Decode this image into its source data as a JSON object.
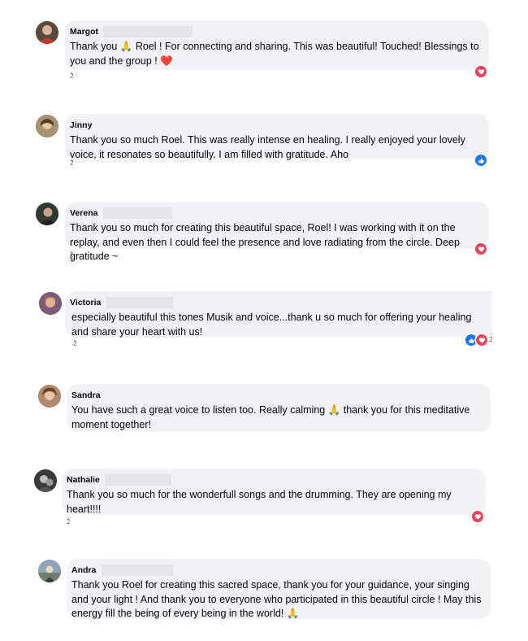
{
  "comments": [
    {
      "author": "Margot",
      "text": "Thank you 🙏 Roel ! For connecting and sharing. This was beautiful! Touched! Blessings to you and the group ! ❤️",
      "meta": "ُ2",
      "reactions": [
        "love"
      ],
      "colors": {
        "avatar_bg": "#5a4a3e",
        "avatar_fg": "#d8b59a"
      }
    },
    {
      "author": "Jinny",
      "text": "Thank you so much Roel. This was really intense en healing. I really enjoyed your lovely voice, it resonates so beautifully. I am filled with gratitude. Aho",
      "meta": "ُ2",
      "reactions": [
        "like"
      ],
      "colors": {
        "avatar_bg": "#a89270",
        "avatar_fg": "#e2c9a8"
      }
    },
    {
      "author": "Verena",
      "text": "Thank you so much for creating this beautiful space, Roel! I was working with it on the replay, and even then I could feel the presence and love radiating from the circle. Deep gratitude ~",
      "meta": "ُ2",
      "reactions": [
        "love"
      ],
      "colors": {
        "avatar_bg": "#2f3a30",
        "avatar_fg": "#c9a38a"
      }
    },
    {
      "author": "Victoria",
      "text": "especially beautiful this tones Musik and voice...thank u so much for offering your healing and share your heart with us!",
      "meta": "ُ2",
      "reactions": [
        "like",
        "love"
      ],
      "reaction_count": "2",
      "colors": {
        "avatar_bg": "#7d5a78",
        "avatar_fg": "#e0b48f"
      }
    },
    {
      "author": "Sandra",
      "text": "You have such a great voice to listen too. Really calming 🙏 thank you for this meditative moment together!",
      "meta": "",
      "reactions": [],
      "colors": {
        "avatar_bg": "#b08a6a",
        "avatar_fg": "#e6c6a8"
      }
    },
    {
      "author": "Nathalie",
      "text": "Thank you so much for the wonderfull songs and the drumming. They are opening my heart!!!!",
      "meta": "ُ2",
      "reactions": [
        "love"
      ],
      "colors": {
        "avatar_bg": "#3a3a3a",
        "avatar_fg": "#bdbdbd"
      }
    },
    {
      "author": "Andra",
      "text": "Thank you Roel for creating this sacred space, thank you for your guidance, your singing and your light ! And thank you to everyone who participated in this beautiful circle ! May this energy fill the being of every being in the world! 🙏",
      "meta": "",
      "reactions": [],
      "colors": {
        "avatar_bg": "#8fa4b8",
        "avatar_fg": "#e7d8c4"
      }
    }
  ]
}
